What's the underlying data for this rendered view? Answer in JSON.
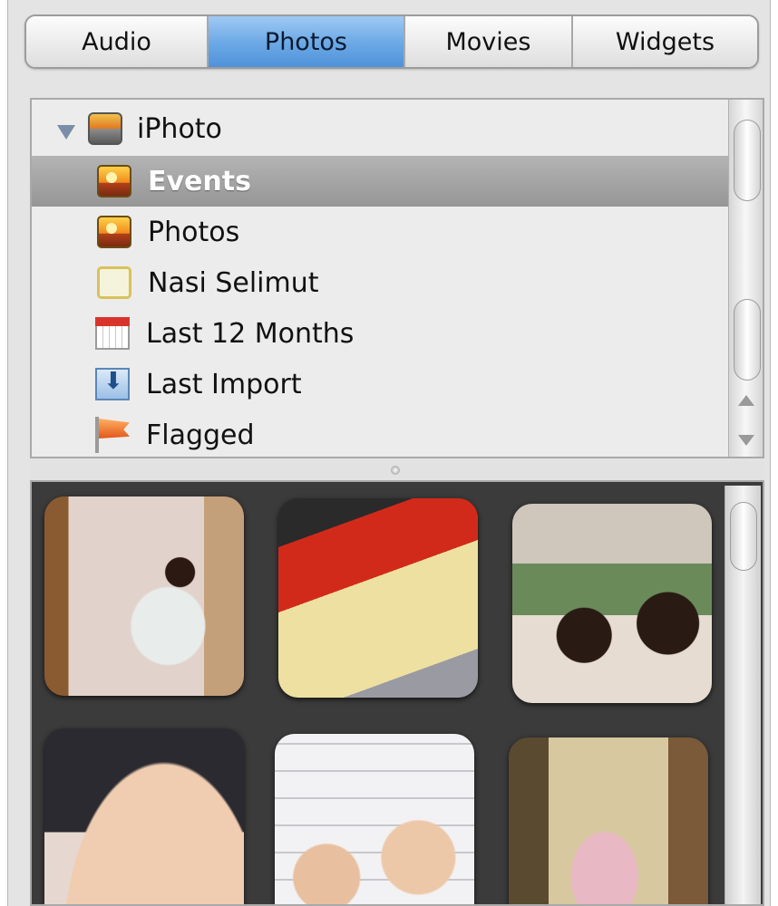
{
  "tabs": [
    {
      "label": "Audio",
      "selected": false
    },
    {
      "label": "Photos",
      "selected": true
    },
    {
      "label": "Movies",
      "selected": false
    },
    {
      "label": "Widgets",
      "selected": false
    }
  ],
  "source_list": {
    "root": {
      "label": "iPhoto",
      "icon": "iphoto-icon",
      "expanded": true
    },
    "items": [
      {
        "label": "Events",
        "icon": "events-icon",
        "selected": true
      },
      {
        "label": "Photos",
        "icon": "photos-icon",
        "selected": false
      },
      {
        "label": "Nasi Selimut",
        "icon": "album-icon",
        "selected": false
      },
      {
        "label": "Last 12 Months",
        "icon": "calendar-icon",
        "selected": false
      },
      {
        "label": "Last Import",
        "icon": "import-icon",
        "selected": false
      },
      {
        "label": "Flagged",
        "icon": "flag-icon",
        "selected": false
      }
    ]
  },
  "colors": {
    "tab_selected": "#6eaae6",
    "row_selected": "#a5a5a5",
    "grid_background": "#3b3b3b"
  },
  "photo_grid": {
    "thumbnail_count": 6
  }
}
